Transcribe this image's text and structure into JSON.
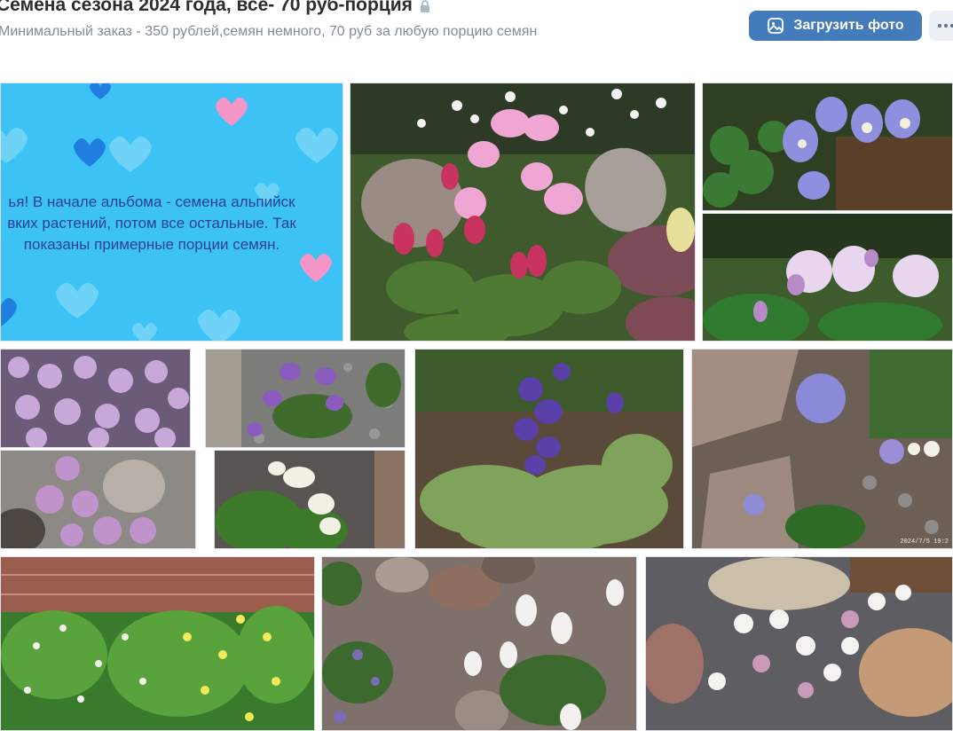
{
  "album": {
    "title": "Семена сезона 2024 года, все- 70 руб-порция",
    "description": "Минимальный заказ - 350 рублей,семян немного, 70 руб за любую порцию семян"
  },
  "actions": {
    "upload_label": "Загрузить фото",
    "more_icon": "more-dots-icon",
    "upload_icon": "photo-icon",
    "lock_icon": "lock-icon"
  },
  "banner": {
    "line1": "ья! В начале альбома - семена альпийск",
    "line2": "вких растений, потом все остальные. Так",
    "line3": "показаны примерные порции семян."
  },
  "photos": {
    "stamp": "2024/7/5 19:2"
  },
  "colors": {
    "accent": "#447bba",
    "banner": "#3cc2f4",
    "banner_text": "#2a3f9b"
  }
}
